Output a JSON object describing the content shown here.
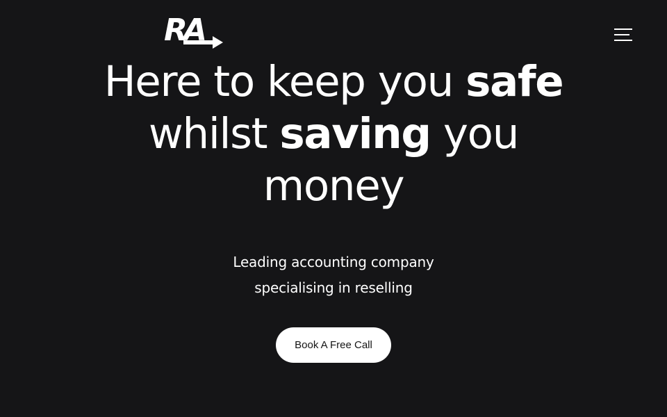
{
  "header": {
    "logo_text": "RA",
    "menu_icon": "hamburger-menu-icon"
  },
  "hero": {
    "headline": {
      "line1_a": "Here to keep you ",
      "line1_b": "safe",
      "line2_a": "whilst ",
      "line2_b": "saving",
      "line2_c": " you",
      "line3": "money"
    },
    "subtitle_line1": "Leading accounting company",
    "subtitle_line2": "specialising in reselling",
    "cta_label": "Book A Free Call"
  },
  "colors": {
    "background": "#151517",
    "text": "#ffffff",
    "button_bg": "#ffffff",
    "button_text": "#141414"
  }
}
